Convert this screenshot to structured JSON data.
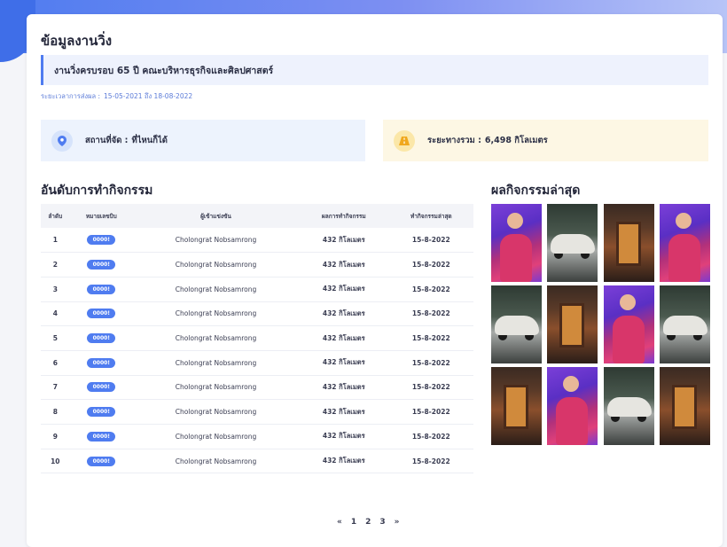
{
  "page": {
    "title": "ข้อมูลงานวิ่ง",
    "event_name": "งานวิ่งครบรอบ 65 ปี คณะบริหารธุรกิจและศิลปศาสตร์",
    "period_label": "ระยะเวลาการส่งผล :",
    "period_value": "15-05-2021 ถึง 18-08-2022"
  },
  "info": {
    "location_label": "สถานที่จัด :",
    "location_value": "ที่ไหนก็ได้",
    "distance_label": "ระยะทางรวม :",
    "distance_value": "6,498 กิโลเมตร",
    "location_icon": "map-pin-icon",
    "distance_icon": "road-icon",
    "location_icon_color": "#4f7cf0",
    "distance_icon_color": "#f0a81c"
  },
  "ranking": {
    "title": "อันดับการทำกิจกรรม",
    "headers": [
      "ลำดับ",
      "หมายเลขบิบ",
      "ผู้เข้าแข่งขัน",
      "ผลการทำกิจกรรม",
      "ทำกิจกรรมล่าสุด"
    ],
    "rows": [
      {
        "rank": "1",
        "bib": "0000!",
        "name": "Cholongrat Nobsamrong",
        "result": "432 กิโลเมตร",
        "date": "15-8-2022"
      },
      {
        "rank": "2",
        "bib": "0000!",
        "name": "Cholongrat Nobsamrong",
        "result": "432 กิโลเมตร",
        "date": "15-8-2022"
      },
      {
        "rank": "3",
        "bib": "0000!",
        "name": "Cholongrat Nobsamrong",
        "result": "432 กิโลเมตร",
        "date": "15-8-2022"
      },
      {
        "rank": "4",
        "bib": "0000!",
        "name": "Cholongrat Nobsamrong",
        "result": "432 กิโลเมตร",
        "date": "15-8-2022"
      },
      {
        "rank": "5",
        "bib": "0000!",
        "name": "Cholongrat Nobsamrong",
        "result": "432 กิโลเมตร",
        "date": "15-8-2022"
      },
      {
        "rank": "6",
        "bib": "0000!",
        "name": "Cholongrat Nobsamrong",
        "result": "432 กิโลเมตร",
        "date": "15-8-2022"
      },
      {
        "rank": "7",
        "bib": "0000!",
        "name": "Cholongrat Nobsamrong",
        "result": "432 กิโลเมตร",
        "date": "15-8-2022"
      },
      {
        "rank": "8",
        "bib": "0000!",
        "name": "Cholongrat Nobsamrong",
        "result": "432 กิโลเมตร",
        "date": "15-8-2022"
      },
      {
        "rank": "9",
        "bib": "0000!",
        "name": "Cholongrat Nobsamrong",
        "result": "432 กิโลเมตร",
        "date": "15-8-2022"
      },
      {
        "rank": "10",
        "bib": "0000!",
        "name": "Cholongrat Nobsamrong",
        "result": "432 กิโลเมตร",
        "date": "15-8-2022"
      }
    ]
  },
  "latest": {
    "title": "ผลกิจกรรมล่าสุด",
    "photos": [
      "woman",
      "car",
      "shop",
      "woman",
      "car",
      "shop",
      "woman",
      "car",
      "shop",
      "woman",
      "car",
      "shop"
    ]
  },
  "pagination": {
    "prev": "«",
    "pages": [
      "1",
      "2",
      "3"
    ],
    "next": "»"
  },
  "colors": {
    "accent": "#4f7cf0",
    "location_bg": "#edf3fd",
    "distance_bg": "#fdf7e4"
  }
}
